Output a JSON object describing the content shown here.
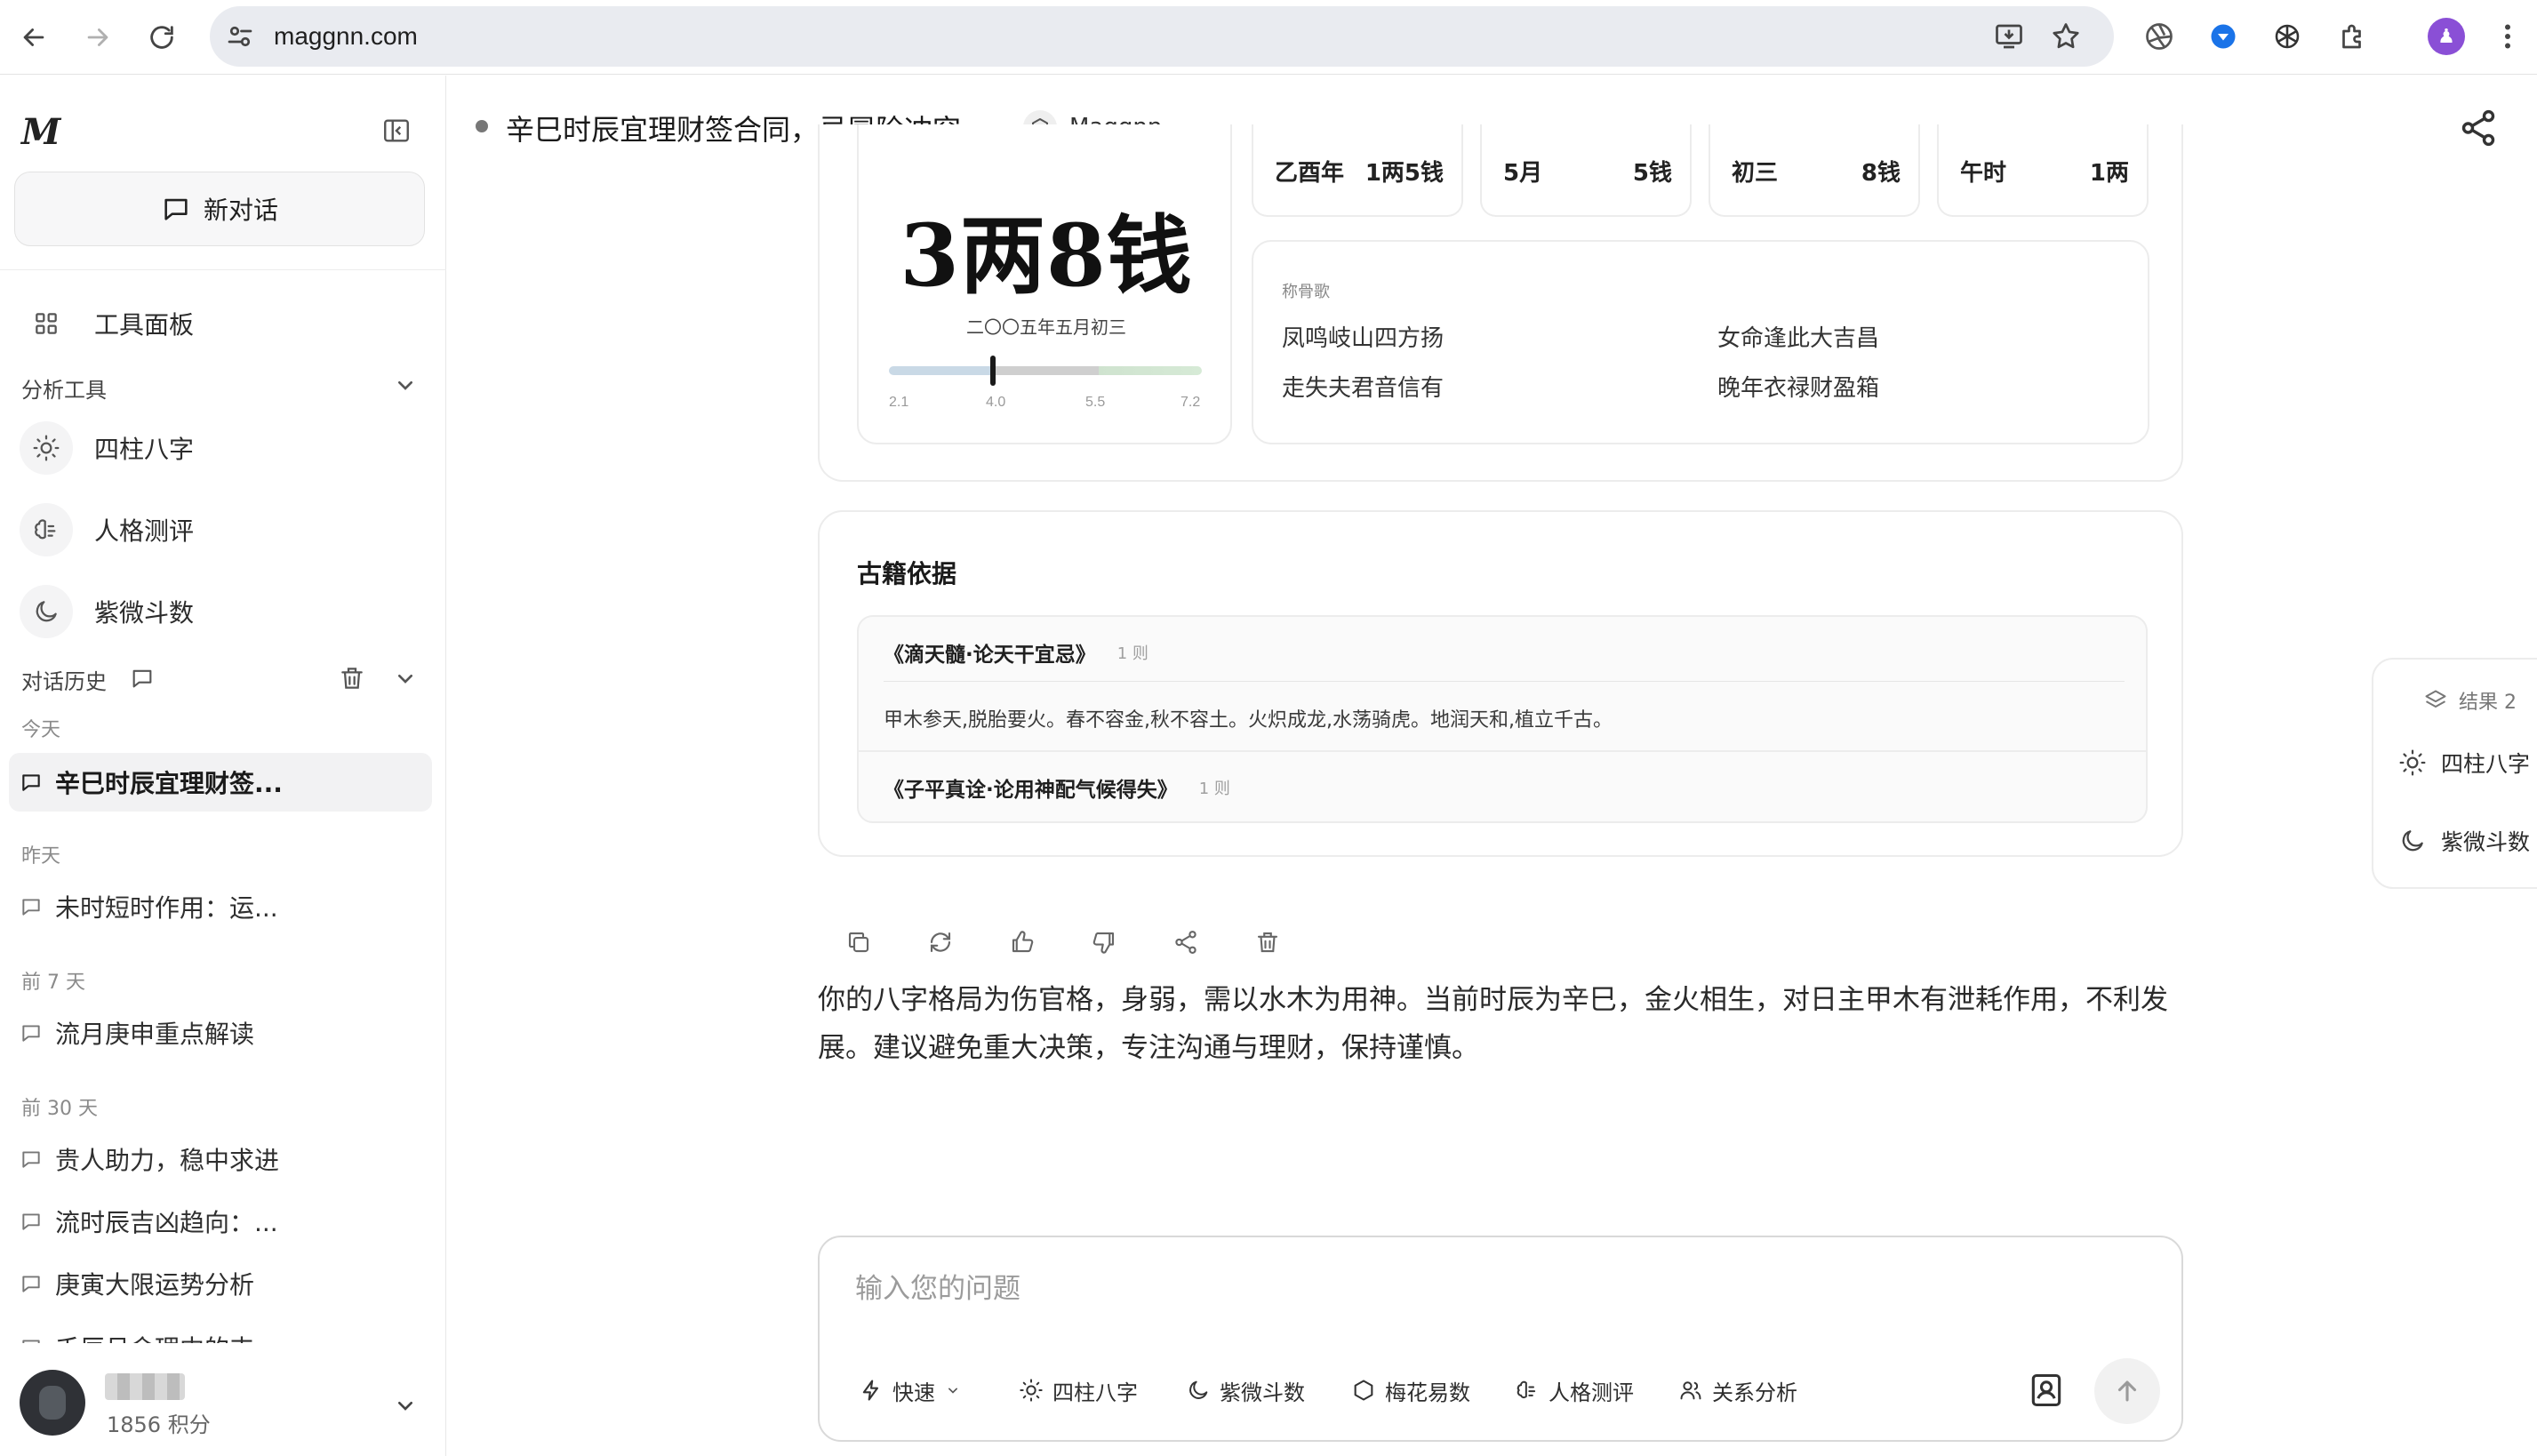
{
  "browser": {
    "url": "maggnn.com",
    "profile_initial": "♟"
  },
  "sidebar": {
    "logo": "M",
    "new_chat_label": "新对话",
    "tool_panel_label": "工具面板",
    "analysis_tools_label": "分析工具",
    "tools": [
      {
        "label": "四柱八字",
        "icon": "sun-icon"
      },
      {
        "label": "人格测评",
        "icon": "brain-icon"
      },
      {
        "label": "紫微斗数",
        "icon": "moon-icon"
      }
    ],
    "history_label": "对话历史",
    "groups": [
      {
        "label": "今天",
        "items": [
          "辛巳时辰宜理财签..."
        ]
      },
      {
        "label": "昨天",
        "items": [
          "未时短时作用：运..."
        ]
      },
      {
        "label": "前 7 天",
        "items": [
          "流月庚申重点解读"
        ]
      },
      {
        "label": "前 30 天",
        "items": [
          "贵人助力，稳中求进",
          "流时辰吉凶趋向：...",
          "庚寅大限运势分析",
          "壬辰月命理中的丰..."
        ]
      }
    ],
    "user": {
      "points": "1856 积分"
    }
  },
  "header": {
    "title": "辛巳时辰宜理财签合同，忌冒险冲突。",
    "model": "Maggnn"
  },
  "bone_weight": {
    "value": "3两8钱",
    "date": "二〇〇五年五月初三",
    "scale_min": 2.1,
    "scale_max": 7.2,
    "marker_value": 3.8,
    "ticks": [
      "2.1",
      "4.0",
      "5.5",
      "7.2"
    ],
    "pillars": [
      {
        "left": "乙酉年",
        "right": "1两5钱"
      },
      {
        "left": "5月",
        "right": "5钱"
      },
      {
        "left": "初三",
        "right": "8钱"
      },
      {
        "left": "午时",
        "right": "1两"
      }
    ],
    "poem_label": "称骨歌",
    "poem_lines": [
      "凤鸣岐山四方扬",
      "女命逢此大吉昌",
      "走失夫君音信有",
      "晚年衣禄财盈箱"
    ]
  },
  "references": {
    "title": "古籍依据",
    "items": [
      {
        "book": "《滴天髓·论天干宜忌》",
        "count": "1 则",
        "body": "甲木参天,脱胎要火。春不容金,秋不容土。火炽成龙,水荡骑虎。地润天和,植立千古。"
      },
      {
        "book": "《子平真诠·论用神配气候得失》",
        "count": "1 则"
      }
    ]
  },
  "answer": "你的八字格局为伤官格，身弱，需以水木为用神。当前时辰为辛巳，金火相生，对日主甲木有泄耗作用，不利发展。建议避免重大决策，专注沟通与理财，保持谨慎。",
  "result_panel": {
    "head": "结果 2",
    "items": [
      "四柱八字",
      "紫微斗数"
    ]
  },
  "composer": {
    "placeholder": "输入您的问题",
    "mode": "快速",
    "tools": [
      "四柱八字",
      "紫微斗数",
      "梅花易数",
      "人格测评",
      "关系分析"
    ]
  }
}
